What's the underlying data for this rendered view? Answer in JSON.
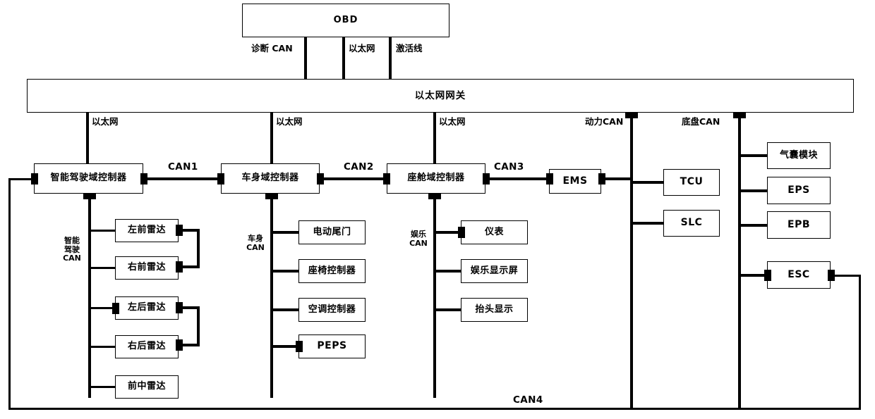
{
  "diagram": {
    "title": "OBD",
    "obd": {
      "label": "OBD"
    },
    "gateway": {
      "label": "以太网网关"
    },
    "obd_links": [
      {
        "label": "诊断 CAN"
      },
      {
        "label": "以太网"
      },
      {
        "label": "激活线"
      }
    ],
    "gateway_links": [
      {
        "label": "以太网"
      },
      {
        "label": "以太网"
      },
      {
        "label": "以太网"
      },
      {
        "label": "动力CAN"
      },
      {
        "label": "底盘CAN"
      }
    ],
    "controllers": [
      {
        "label": "智能驾驶域控制器"
      },
      {
        "label": "车身域控制器"
      },
      {
        "label": "座舱域控制器"
      },
      {
        "label": "EMS"
      }
    ],
    "bus_labels": [
      {
        "label": "CAN1"
      },
      {
        "label": "CAN2"
      },
      {
        "label": "CAN3"
      },
      {
        "label": "CAN4"
      }
    ],
    "sub_bus_labels": [
      {
        "label": "智能\n驾驶\nCAN",
        "line1": "智能",
        "line2": "驾驶",
        "line3": "CAN"
      },
      {
        "label": "车身\nCAN",
        "line1": "车身",
        "line2": "CAN"
      },
      {
        "label": "娱乐\nCAN",
        "line1": "娱乐",
        "line2": "CAN"
      }
    ],
    "adas_nodes": [
      {
        "label": "左前雷达"
      },
      {
        "label": "右前雷达"
      },
      {
        "label": "左后雷达"
      },
      {
        "label": "右后雷达"
      },
      {
        "label": "前中雷达"
      }
    ],
    "body_nodes": [
      {
        "label": "电动尾门"
      },
      {
        "label": "座椅控制器"
      },
      {
        "label": "空调控制器"
      },
      {
        "label": "PEPS"
      }
    ],
    "infotainment_nodes": [
      {
        "label": "仪表"
      },
      {
        "label": "娱乐显示屏"
      },
      {
        "label": "抬头显示"
      }
    ],
    "powertrain_nodes": [
      {
        "label": "TCU"
      },
      {
        "label": "SLC"
      }
    ],
    "chassis_nodes": [
      {
        "label": "气囊模块"
      },
      {
        "label": "EPS"
      },
      {
        "label": "EPB"
      },
      {
        "label": "ESC"
      }
    ],
    "colors": {
      "line": "#000000",
      "box_fill": "#ffffff",
      "text": "#000000",
      "background": "#ffffff"
    }
  }
}
